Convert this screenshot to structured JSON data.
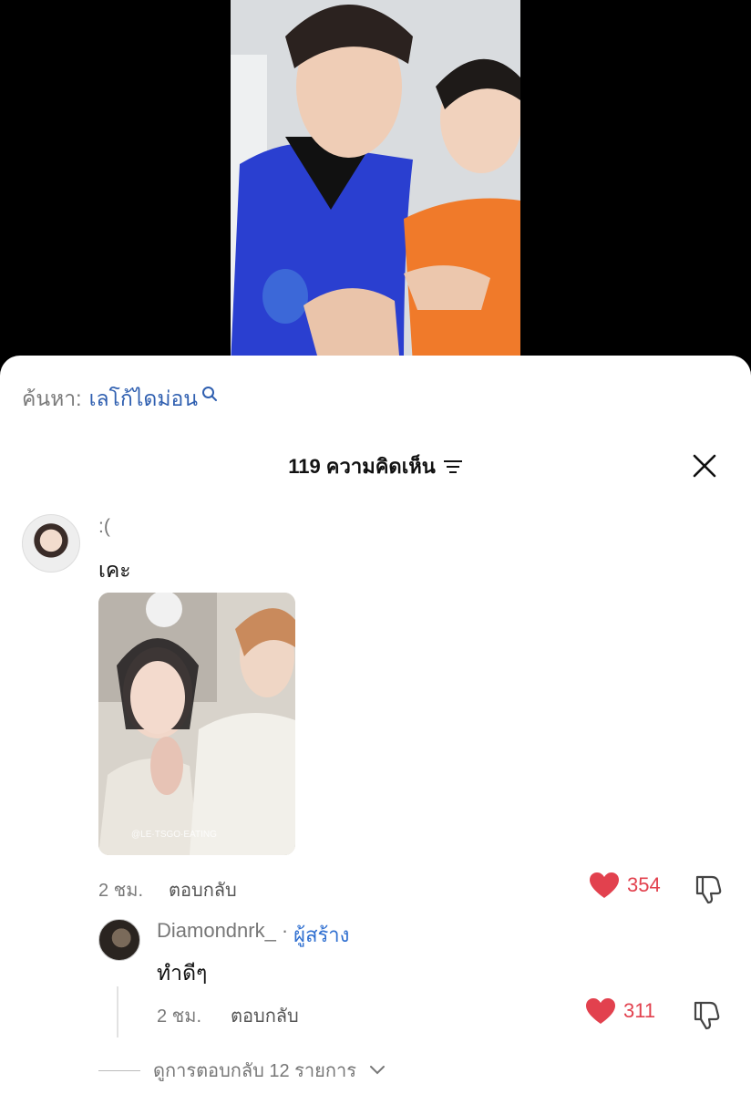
{
  "search": {
    "label": "ค้นหา:",
    "term": "เลโก้ไดม่อน"
  },
  "header": {
    "count_label": "119 ความคิดเห็น"
  },
  "comment": {
    "username": ":(",
    "text": "เคะ",
    "image_watermark": "@LE·TSGO·EATING",
    "time": "2 ชม.",
    "reply_label": "ตอบกลับ",
    "likes": "354"
  },
  "reply": {
    "username": "Diamondnrk_",
    "separator": "·",
    "creator_badge": "ผู้สร้าง",
    "text": "ทำดีๆ",
    "time": "2 ชม.",
    "reply_label": "ตอบกลับ",
    "likes": "311"
  },
  "more_replies": {
    "label": "ดูการตอบกลับ 12 รายการ"
  },
  "colors": {
    "accent": "#e2414e",
    "link": "#2f5fb0",
    "creator": "#2f6fd0"
  }
}
